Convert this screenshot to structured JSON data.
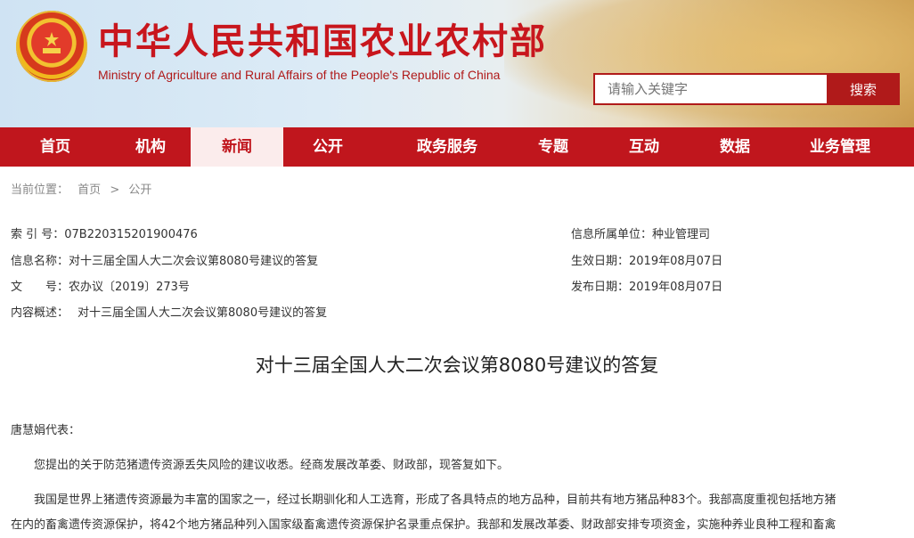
{
  "header": {
    "title_cn": "中华人民共和国农业农村部",
    "title_en": "Ministry of Agriculture and Rural Affairs of the People's Republic of China",
    "emblem_icon": "national-emblem-icon"
  },
  "search": {
    "placeholder": "请输入关键字",
    "button_label": "搜索"
  },
  "nav": {
    "items": [
      "首页",
      "机构",
      "新闻",
      "公开",
      "政务服务",
      "专题",
      "互动",
      "数据",
      "业务管理"
    ],
    "active_index": 2
  },
  "breadcrumb": {
    "label": "当前位置：",
    "home": "首页",
    "separator": ">",
    "current": "公开"
  },
  "meta": {
    "index_no_label": "索 引 号：",
    "index_no": "07B220315201900476",
    "info_name_label": "信息名称：",
    "info_name": "对十三届全国人大二次会议第8080号建议的答复",
    "doc_no_label": "文　　号：",
    "doc_no": "农办议〔2019〕273号",
    "summary_label": "内容概述：",
    "summary": "对十三届全国人大二次会议第8080号建议的答复",
    "dept_label": "信息所属单位：",
    "dept": "种业管理司",
    "effective_label": "生效日期：",
    "effective": "2019年08月07日",
    "publish_label": "发布日期：",
    "publish": "2019年08月07日"
  },
  "article": {
    "title": "对十三届全国人大二次会议第8080号建议的答复",
    "greeting": "唐慧娟代表：",
    "p1": "您提出的关于防范猪遗传资源丢失风险的建议收悉。经商发展改革委、财政部，现答复如下。",
    "p2a": "我国是世界上猪遗传资源最为丰富的国家之一，经过长期驯化和人工选育，形成了各具特点的地方品种，目前共有地方猪品种83个。我部高度重视包括地方猪",
    "p2b": "在内的畜禽遗传资源保护，将42个地方猪品种列入国家级畜禽遗传资源保护名录重点保护。我部和发展改革委、财政部安排专项资金，实施种养业良种工程和畜禽"
  },
  "colors": {
    "brand_red": "#c0161d",
    "active_tab_bg": "#fbecec"
  }
}
